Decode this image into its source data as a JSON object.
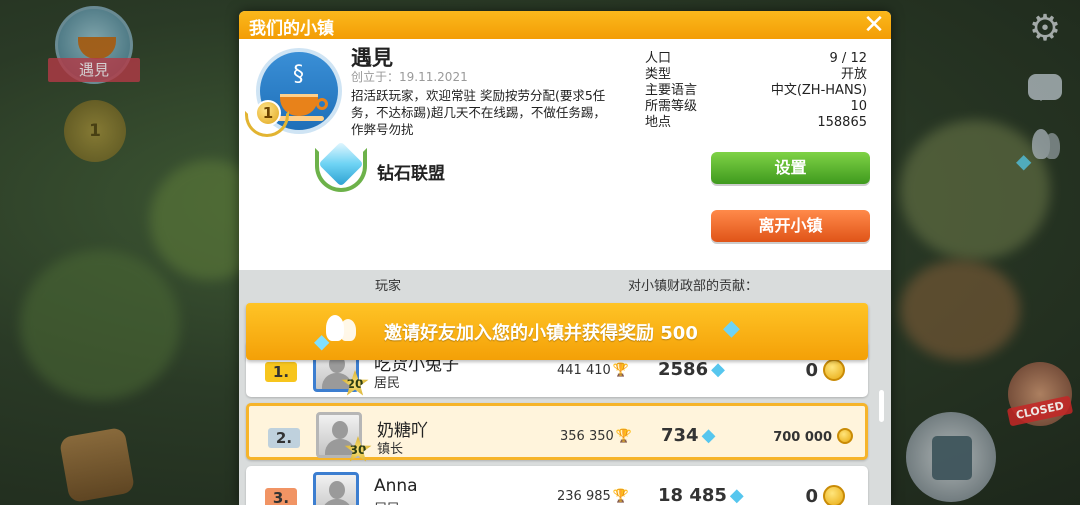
{
  "hud": {
    "town_label": "遇見",
    "level": "1",
    "closed_label": "CLOSED"
  },
  "dialog": {
    "title": "我们的小镇",
    "close_icon": "✕"
  },
  "town": {
    "name": "遇見",
    "founded": "创立于：19.11.2021",
    "description": "招活跃玩家，欢迎常驻 奖励按劳分配(要求5任务，不达标踢)超几天不在线踢，不做任务踢，作弊号勿扰",
    "level": "1",
    "league": "钻石联盟"
  },
  "stats": [
    {
      "label": "人口",
      "value": "9 / 12"
    },
    {
      "label": "类型",
      "value": "开放"
    },
    {
      "label": "主要语言",
      "value": "中文(ZH-HANS)"
    },
    {
      "label": "所需等级",
      "value": "10"
    },
    {
      "label": "地点",
      "value": "158865"
    }
  ],
  "buttons": {
    "settings": "设置",
    "leave": "离开小镇"
  },
  "members": {
    "col_player": "玩家",
    "col_contribution": "对小镇财政部的贡献：",
    "invite_text": "邀请好友加入您的小镇并获得奖励 500",
    "rows": [
      {
        "rank": "1.",
        "name": "吃货小兔子",
        "role": "居民",
        "level": "20",
        "trophies": "441 410",
        "gems": "2586",
        "coins": "0"
      },
      {
        "rank": "2.",
        "name": "奶糖吖",
        "role": "镇长",
        "level": "30",
        "trophies": "356 350",
        "gems": "734",
        "coins": "700 000"
      },
      {
        "rank": "3.",
        "name": "Anna",
        "role": "居民",
        "level": "",
        "trophies": "236 985",
        "gems": "18 485",
        "coins": "0"
      }
    ]
  },
  "icons": {
    "gear": "gear-icon",
    "chat": "chat-icon",
    "friends": "friends-icon",
    "trophy": "🏆",
    "gem": "💎"
  },
  "colors": {
    "header": "#f39d05",
    "settings_button": "#3f9a1e",
    "leave_button": "#e05418",
    "highlight_row": "#fff4dc"
  }
}
